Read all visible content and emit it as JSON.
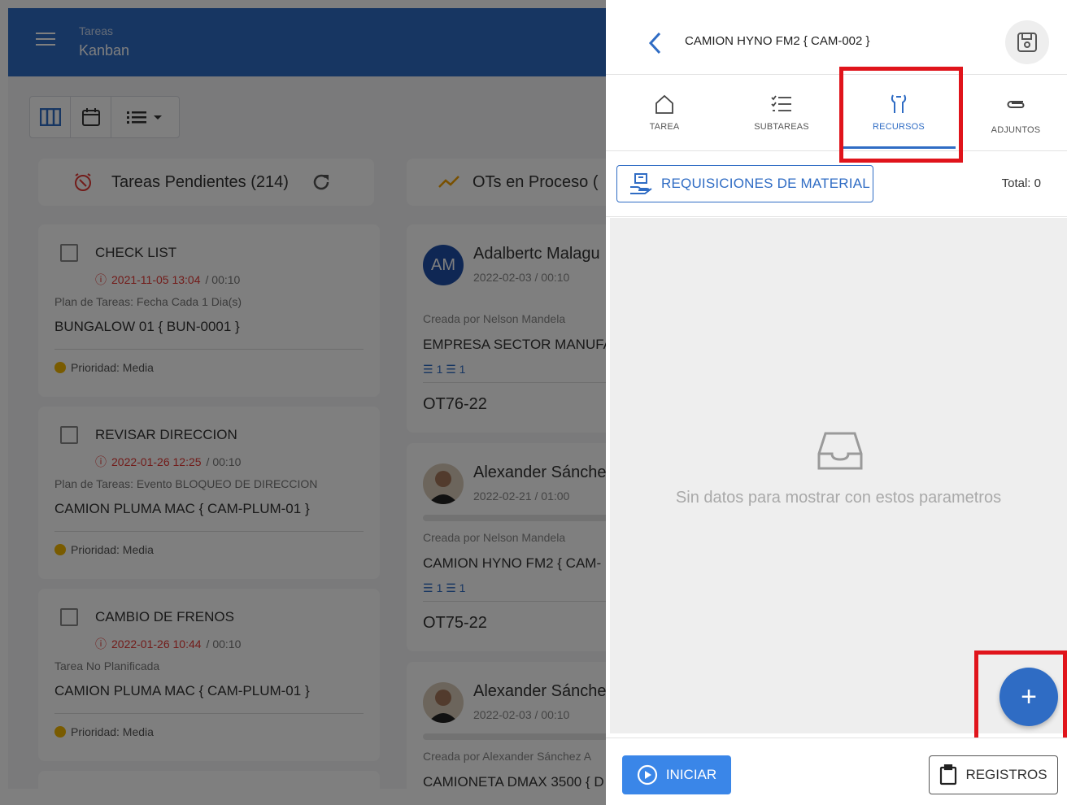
{
  "app": {
    "title": "Tareas",
    "subtitle": "Kanban",
    "columns": [
      {
        "title": "Tareas Pendientes (214)"
      },
      {
        "title": "OTs en Proceso ("
      }
    ],
    "pending_tasks": [
      {
        "title": "CHECK LIST",
        "date": "2021-11-05 13:04",
        "duration": "/ 00:10",
        "plan": "Plan de Tareas: Fecha Cada 1 Dia(s)",
        "asset": "BUNGALOW 01 { BUN-0001 }",
        "priority": "Prioridad: Media"
      },
      {
        "title": "REVISAR DIRECCION",
        "date": "2022-01-26 12:25",
        "duration": "/ 00:10",
        "plan": "Plan de Tareas: Evento BLOQUEO DE DIRECCION",
        "asset": "CAMION PLUMA MAC { CAM-PLUM-01 }",
        "priority": "Prioridad: Media"
      },
      {
        "title": "CAMBIO DE FRENOS",
        "date": "2022-01-26 10:44",
        "duration": "/ 00:10",
        "plan": "Tarea No Planificada",
        "asset": "CAMION PLUMA MAC { CAM-PLUM-01 }",
        "priority": "Prioridad: Media"
      }
    ],
    "work_orders": [
      {
        "initials": "AM",
        "name": "Adalbertc Malagu",
        "date": "2022-02-03 / 00:10",
        "created_by": "Creada por Nelson Mandela",
        "asset": "EMPRESA SECTOR MANUFA",
        "counts": "1 ☰ 1",
        "code": "OT76-22"
      },
      {
        "initials": "",
        "name": "Alexander Sánche",
        "date": "2022-02-21 / 01:00",
        "created_by": "Creada por Nelson Mandela",
        "asset": "CAMION HYNO FM2 { CAM-",
        "counts": "1 ☰ 1",
        "code": "OT75-22"
      },
      {
        "initials": "",
        "name": "Alexander Sánche",
        "date": "2022-02-03 / 00:10",
        "created_by": "Creada por Alexander Sánchez A",
        "asset": "CAMIONETA DMAX 3500 { D",
        "counts": "",
        "code": ""
      }
    ]
  },
  "panel": {
    "title": "CAMION HYNO FM2 { CAM-002 }",
    "tabs": [
      {
        "label": "TAREA",
        "icon": "home-icon"
      },
      {
        "label": "SUBTAREAS",
        "icon": "checklist-icon"
      },
      {
        "label": "RECURSOS",
        "icon": "tools-icon"
      },
      {
        "label": "ADJUNTOS",
        "icon": "paperclip-icon"
      }
    ],
    "active_tab": "RECURSOS",
    "requisitions_label": "REQUISICIONES DE MATERIAL",
    "total": "Total: 0",
    "empty_message": "Sin datos para mostrar con estos parametros",
    "fab_label": "+",
    "start_label": "INICIAR",
    "logs_label": "REGISTROS"
  },
  "colors": {
    "primary": "#2f6cc4",
    "highlight": "#e0141b",
    "overdue": "#e53935",
    "priority_medium": "#f2b600"
  }
}
